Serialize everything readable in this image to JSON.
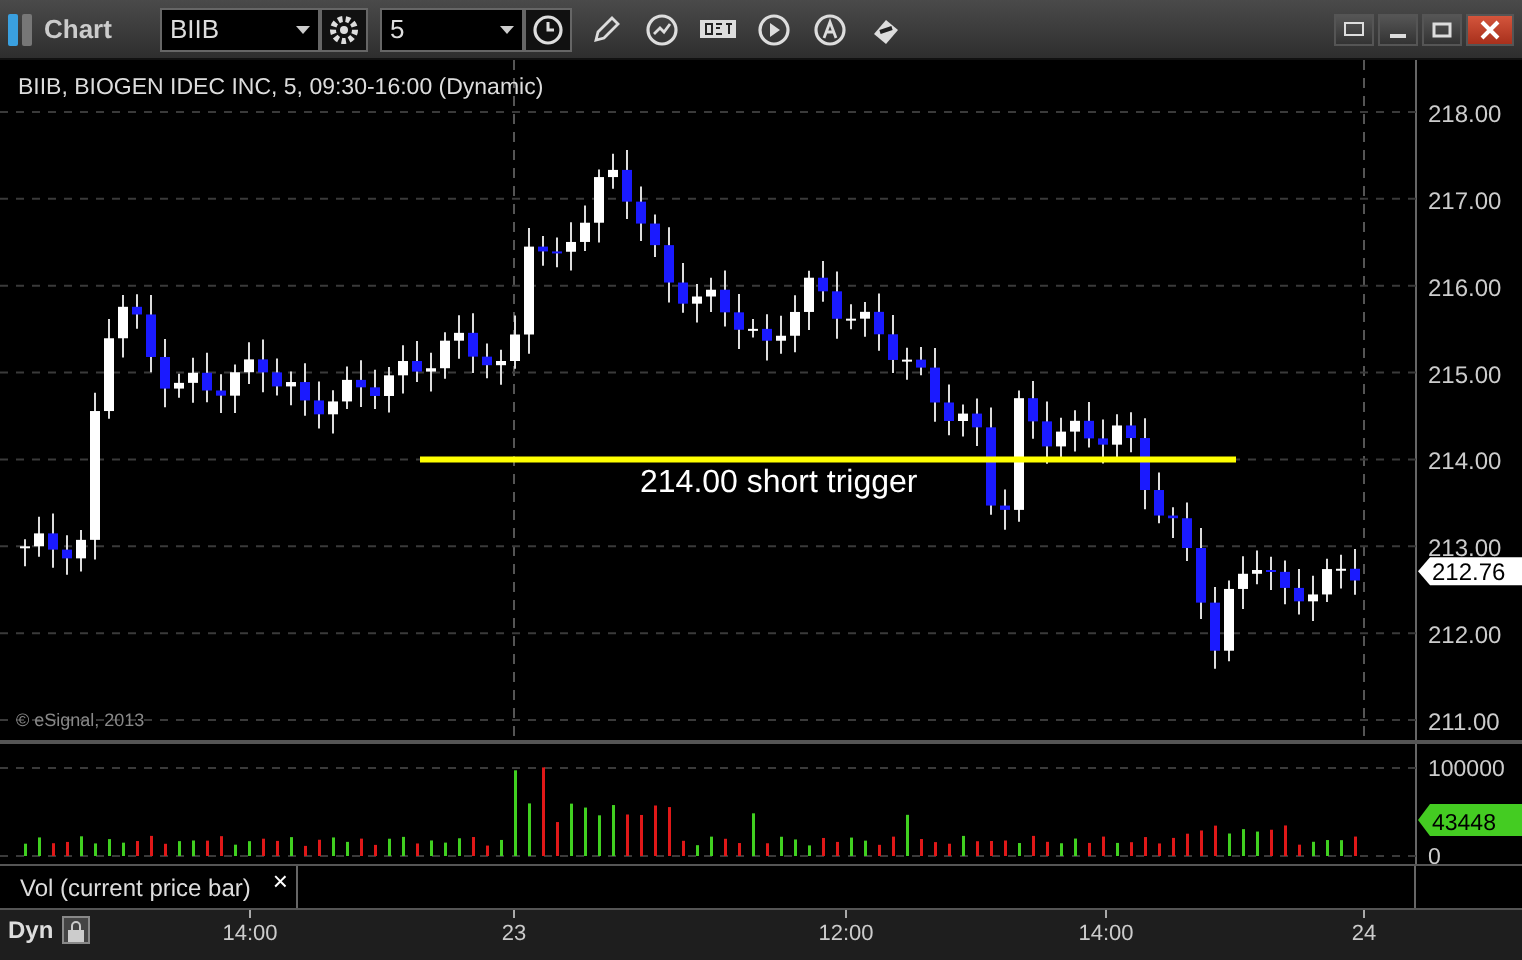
{
  "window": {
    "title": "Chart"
  },
  "toolbar": {
    "symbol": "BIIB",
    "interval": "5"
  },
  "price_pane": {
    "legend": "BIIB, BIOGEN IDEC INC, 5, 09:30-16:00 (Dynamic)",
    "annotation": "214.00 short trigger",
    "copyright": "© eSignal, 2013",
    "ticks": [
      "218.00",
      "217.00",
      "216.00",
      "215.00",
      "214.00",
      "213.00",
      "212.00",
      "211.00"
    ],
    "last_price": "212.76"
  },
  "volume_pane": {
    "ticks": [
      "100000",
      "0"
    ],
    "last_value": "43448"
  },
  "study_bar": {
    "label": "Vol (current price bar)",
    "close": "×"
  },
  "time_axis": {
    "mode": "Dyn",
    "labels": [
      "14:00",
      "23",
      "12:00",
      "14:00",
      "24"
    ]
  }
}
